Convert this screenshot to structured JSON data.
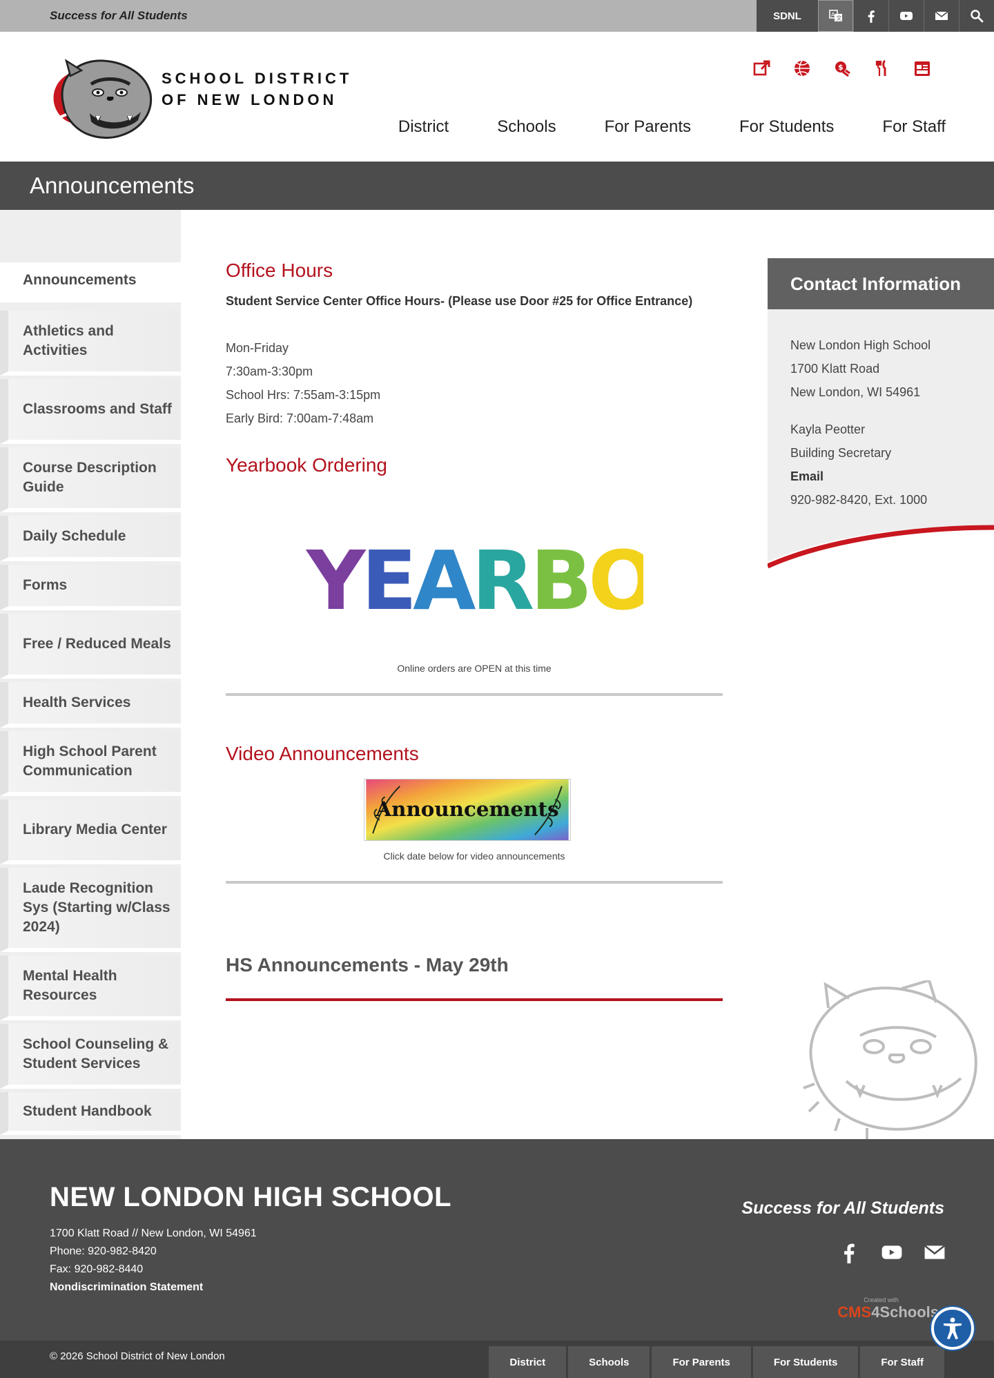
{
  "topbar": {
    "tagline": "Success for All Students",
    "sdnl_label": "SDNL",
    "icons": [
      "translate-icon",
      "facebook-icon",
      "youtube-icon",
      "mail-icon",
      "search-icon"
    ]
  },
  "header": {
    "district_line1": "SCHOOL DISTRICT",
    "district_line2": "OF NEW LONDON",
    "quicklinks": [
      "external-link-icon",
      "basketball-icon",
      "payment-icon",
      "dining-icon",
      "calendar-icon"
    ],
    "nav": [
      "District",
      "Schools",
      "For Parents",
      "For Students",
      "For Staff"
    ]
  },
  "page": {
    "title": "Announcements"
  },
  "sidebar": {
    "items": [
      "Announcements",
      "Athletics and Activities",
      "Classrooms and Staff",
      "Course Description Guide",
      "Daily Schedule",
      "Forms",
      "Free / Reduced Meals",
      "Health Services",
      "High School Parent Communication",
      "Library Media Center",
      "Laude Recognition Sys (Starting w/Class 2024)",
      "Mental Health Resources",
      "School Counseling & Student Services",
      "Student Handbook"
    ]
  },
  "main": {
    "office_hours": {
      "title": "Office Hours",
      "subtitle": "Student Service Center Office Hours- (Please use Door #25 for Office Entrance)",
      "lines": [
        "Mon-Friday",
        "7:30am-3:30pm",
        "School Hrs:  7:55am-3:15pm",
        "Early Bird:  7:00am-7:48am"
      ]
    },
    "yearbook": {
      "title": "Yearbook Ordering",
      "image_text": "YEARBOOK",
      "caption": "Online orders are OPEN at this time"
    },
    "video": {
      "title": "Video Announcements",
      "image_text": "Announcements",
      "caption": "Click date below for video announcements"
    },
    "hs_announcement": "HS Announcements - May 29th"
  },
  "contact": {
    "title": "Contact Information",
    "school": "New London High School",
    "street": "1700 Klatt Road",
    "city": "New London, WI 54961",
    "name": "Kayla Peotter",
    "role": "Building Secretary",
    "email_label": "Email",
    "phone": "920-982-8420, Ext. 1000"
  },
  "footer": {
    "school": "NEW LONDON HIGH SCHOOL",
    "address": "1700 Klatt Road   //   New London, WI 54961",
    "phone": "Phone:   920-982-8420",
    "fax": "Fax:   920-982-8440",
    "nondiscrimination": "Nondiscrimination Statement",
    "motto": "Success for All Students",
    "cms_small": "Created with",
    "cms_a": "CMS",
    "cms_b": "4Schools",
    "copyright": "© 2026 School District of New London",
    "nav": [
      "District",
      "Schools",
      "For Parents",
      "For Students",
      "For Staff"
    ]
  },
  "colors": {
    "brand_red": "#b3121d",
    "dark_gray": "#4c4c4c",
    "panel_gray": "#eeeeee"
  }
}
